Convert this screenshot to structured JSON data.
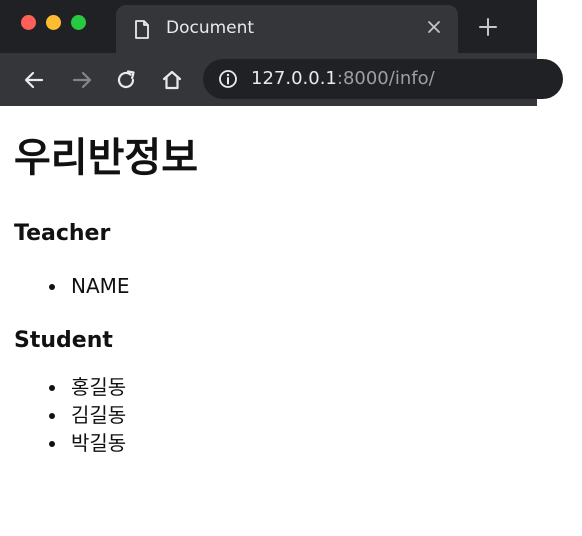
{
  "browser": {
    "tab_title": "Document",
    "url_host": "127.0.0.1",
    "url_rest": ":8000/info/"
  },
  "page": {
    "heading": "우리반정보",
    "teacher_heading": "Teacher",
    "teachers": [
      "NAME"
    ],
    "student_heading": "Student",
    "students": [
      "홍길동",
      "김길동",
      "박길동"
    ]
  },
  "colors": {
    "tabstrip_bg": "#202124",
    "toolbar_bg": "#35363a",
    "traffic_red": "#fe5f57",
    "traffic_yellow": "#febc2e",
    "traffic_green": "#28c840"
  }
}
